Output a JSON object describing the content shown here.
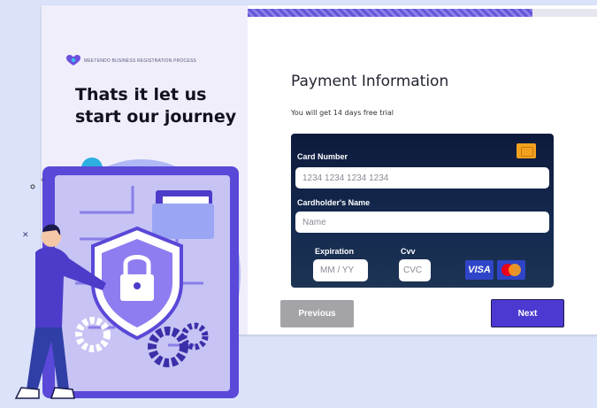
{
  "brand": {
    "name": "MEETENDO BUSINESS REGISTRATION PROCESS",
    "logo_icon": "heart-logo-icon"
  },
  "left_panel": {
    "headline": "Thats it let us start our journey"
  },
  "progress": {
    "value": 0.79
  },
  "payment": {
    "title": "Payment Information",
    "subtitle": "You will get 14 days free trial",
    "card_number_label": "Card Number",
    "card_number_placeholder": "1234 1234 1234 1234",
    "cardholder_label": "Cardholder's Name",
    "cardholder_placeholder": "Name",
    "expiration_label": "Expiration",
    "expiration_placeholder": "MM / YY",
    "cvv_label": "Cvv",
    "cvv_placeholder": "CVC",
    "visa_label": "VISA",
    "chip_icon": "card-chip-icon",
    "mastercard_icon": "mastercard-icon"
  },
  "buttons": {
    "previous": "Previous",
    "next": "Next"
  },
  "colors": {
    "accent": "#4c39d1",
    "progress": "#6355d6",
    "card_bg": "#0e1a3c",
    "chip": "#f2a11f",
    "page_bg": "#dbe3fb"
  }
}
